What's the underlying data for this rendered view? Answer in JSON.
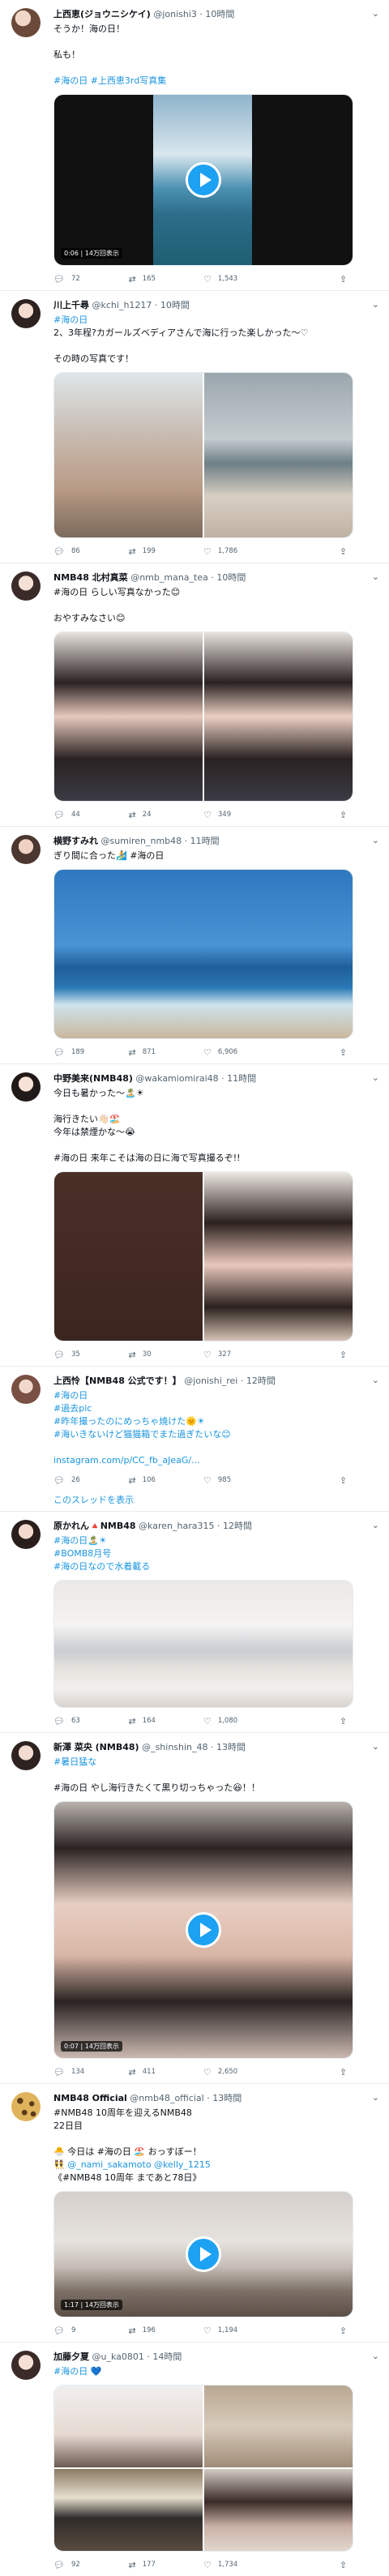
{
  "colors": {
    "link": "#1b95e0",
    "play": "#1da1f2",
    "muted": "#536471",
    "divider": "#e6ecf0"
  },
  "icons": {
    "reply": "reply-icon",
    "retweet": "retweet-icon",
    "like": "heart-icon",
    "share": "share-icon",
    "more": "chevron-down-icon",
    "play": "play-icon"
  },
  "tweets": [
    {
      "name": "上西恵(ジョウニシケイ)",
      "handle": "@jonishi3",
      "time": "10時間",
      "lines": [
        "そうか！海の日！",
        "",
        "私も！",
        "",
        "#海の日 #上西恵3rd写真集"
      ],
      "media_badge": "0:06 | 14万回表示",
      "reply": "72",
      "retweet": "165",
      "like": "1,543"
    },
    {
      "name": "川上千尋",
      "handle": "@kchi_h1217",
      "time": "10時間",
      "lines": [
        "#海の日",
        "2、3年程?カガールズベディアさんで海に行った楽しかった〜♡",
        "",
        "その時の写真です！"
      ],
      "reply": "86",
      "retweet": "199",
      "like": "1,786"
    },
    {
      "name": "NMB48 北村真菜",
      "handle": "@nmb_mana_tea",
      "time": "10時間",
      "lines": [
        "#海の日 らしい写真なかった😊",
        "",
        "おやすみなさい😊"
      ],
      "reply": "44",
      "retweet": "24",
      "like": "349"
    },
    {
      "name": "横野すみれ",
      "handle": "@sumiren_nmb48",
      "time": "11時間",
      "lines": [
        "ぎり間に合った🏄 #海の日"
      ],
      "reply": "189",
      "retweet": "871",
      "like": "6,906"
    },
    {
      "name": "中野美来(NMB48)",
      "handle": "@wakamiomirai48",
      "time": "11時間",
      "lines": [
        "今日も暑かった〜🏝️☀",
        "",
        "海行きたい👋🏻🏖️",
        "今年は禁煙かな〜😭",
        "",
        "#海の日 来年こそは海の日に海で写真撮るぞ!!"
      ],
      "reply": "35",
      "retweet": "30",
      "like": "327"
    },
    {
      "name": "上西怜【NMB48 公式です！】",
      "handle": "@jonishi_rei",
      "time": "12時間",
      "lines": [
        "#海の日",
        "#過去pic",
        "#昨年撮ったのにめっちゃ焼けた🌞☀",
        "#海いきないけど猫猫箱でまた過ぎたいな😊",
        "",
        "instagram.com/p/CC_fb_aJeaG/..."
      ],
      "show_thread": "このスレッドを表示",
      "reply": "26",
      "retweet": "106",
      "like": "985"
    },
    {
      "name": "原かれん🔺NMB48",
      "handle": "@karen_hara315",
      "time": "12時間",
      "lines": [
        "#海の日🏝️☀",
        "#BOMB8月号",
        "#海の日なので水着載る"
      ],
      "reply": "63",
      "retweet": "164",
      "like": "1,080"
    },
    {
      "name": "新澤 菜央 (NMB48)",
      "handle": "@_shinshin_48",
      "time": "13時間",
      "lines": [
        "#暑日猛な",
        "",
        "#海の日 やし海行きたくて黒り切っちゃった😆！！"
      ],
      "media_badge": "0:07 | 14万回表示",
      "reply": "134",
      "retweet": "411",
      "like": "2,650"
    },
    {
      "name": "NMB48 Official",
      "handle": "@nmb48_official",
      "time": "13時間",
      "lines": [
        "#NMB48 10周年を迎えるNMB48",
        "22日目",
        "",
        "🐣 今日は #海の日 🏖️ おっすぼー！",
        "👯 @_nami_sakamoto @kelly_1215",
        "《#NMB48 10周年 まであと78日》"
      ],
      "media_badge": "1:17 | 14万回表示",
      "reply": "9",
      "retweet": "196",
      "like": "1,194"
    },
    {
      "name": "加藤夕夏",
      "handle": "@u_ka0801",
      "time": "14時間",
      "lines": [
        "#海の日 💙"
      ],
      "reply": "92",
      "retweet": "177",
      "like": "1,734"
    }
  ]
}
